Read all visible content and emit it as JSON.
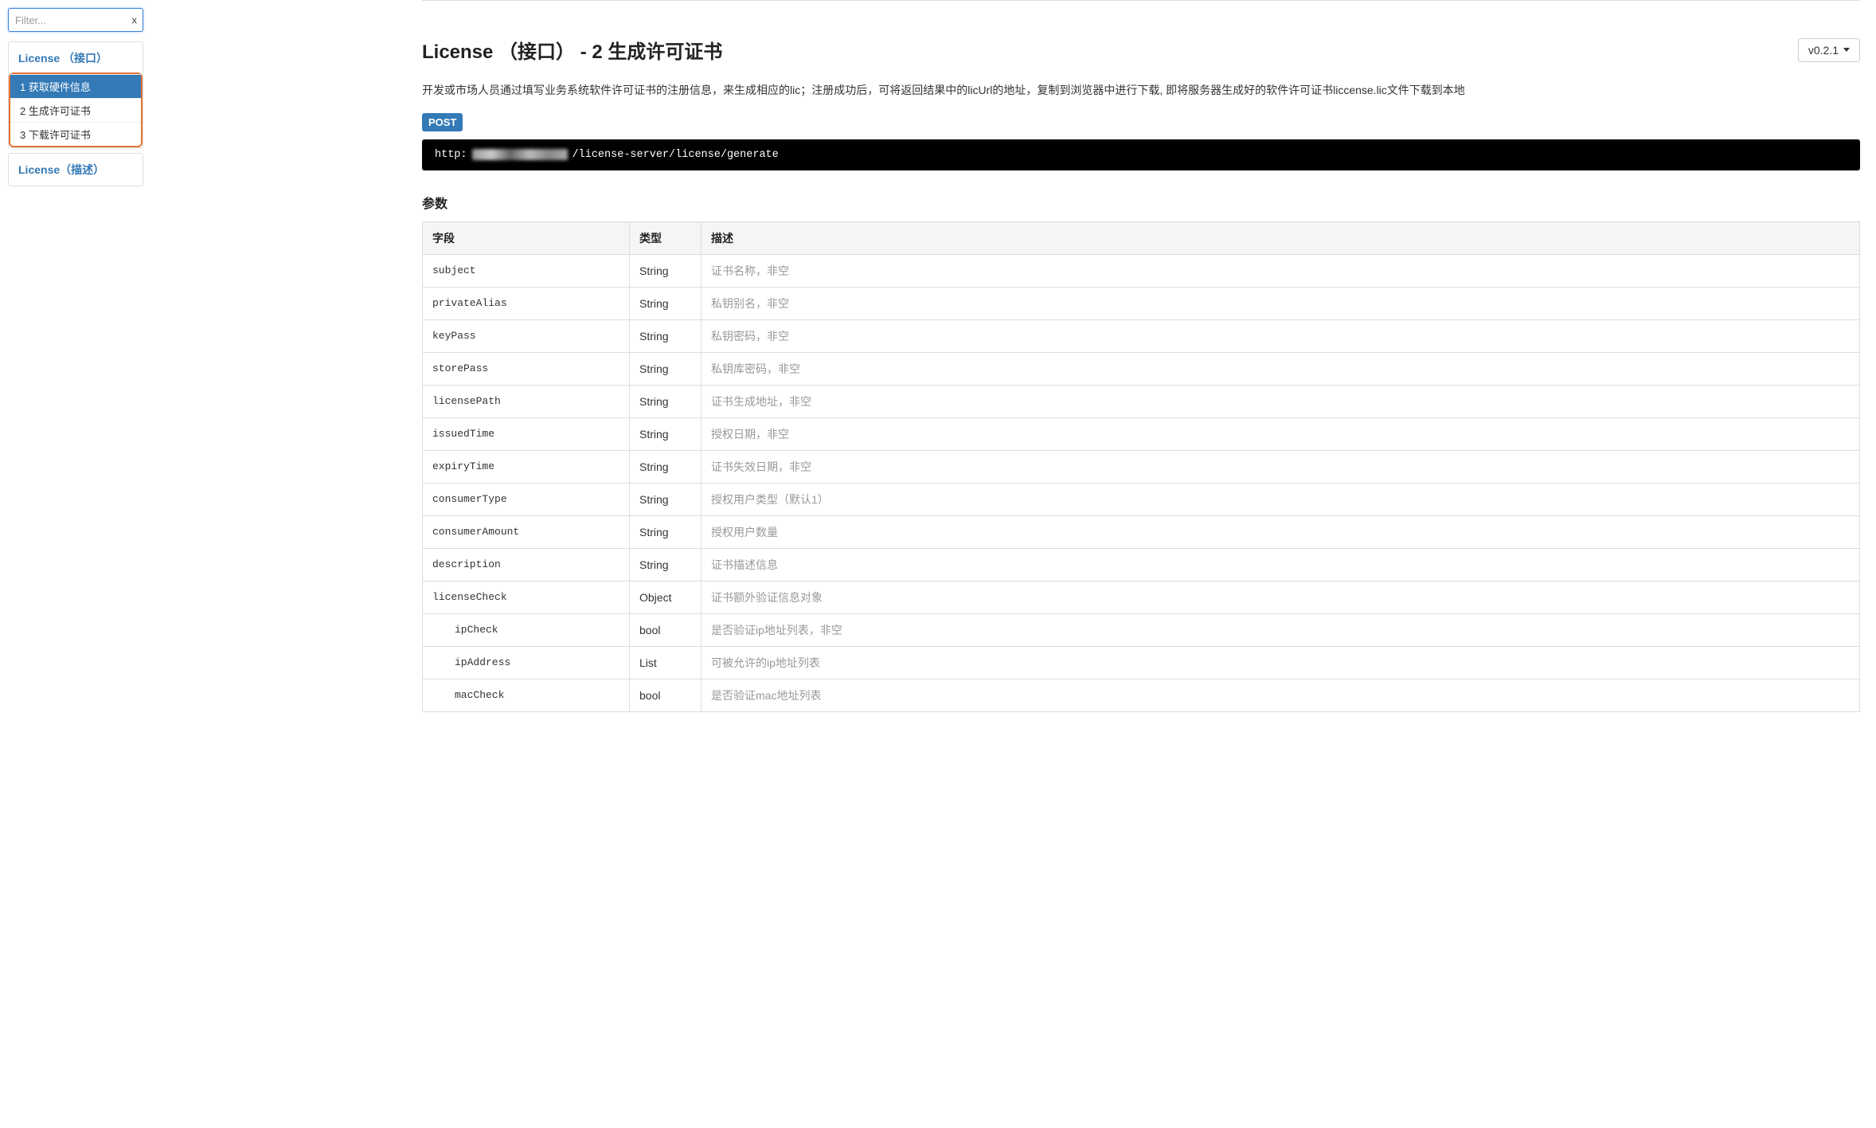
{
  "sidebar": {
    "filter_placeholder": "Filter...",
    "clear_label": "x",
    "groups": [
      {
        "title": "License （接口）",
        "highlighted": true,
        "items": [
          {
            "label": "1 获取硬件信息",
            "active": true
          },
          {
            "label": "2 生成许可证书",
            "active": false
          },
          {
            "label": "3 下载许可证书",
            "active": false
          }
        ]
      },
      {
        "title": "License（描述）",
        "highlighted": false,
        "items": []
      }
    ]
  },
  "header": {
    "title": "License （接口） - 2 生成许可证书",
    "version": "v0.2.1"
  },
  "description": "开发或市场人员通过填写业务系统软件许可证书的注册信息，来生成相应的lic；注册成功后，可将返回结果中的licUrl的地址，复制到浏览器中进行下载, 即将服务器生成好的软件许可证书liccense.lic文件下载到本地",
  "request": {
    "method": "POST",
    "url_prefix": "http:",
    "url_suffix": "/license-server/license/generate"
  },
  "params": {
    "title": "参数",
    "headers": {
      "field": "字段",
      "type": "类型",
      "desc": "描述"
    },
    "rows": [
      {
        "field": "subject",
        "type": "String",
        "desc": "证书名称，非空",
        "indent": false
      },
      {
        "field": "privateAlias",
        "type": "String",
        "desc": "私钥别名，非空",
        "indent": false
      },
      {
        "field": "keyPass",
        "type": "String",
        "desc": "私钥密码，非空",
        "indent": false
      },
      {
        "field": "storePass",
        "type": "String",
        "desc": "私钥库密码，非空",
        "indent": false
      },
      {
        "field": "licensePath",
        "type": "String",
        "desc": "证书生成地址，非空",
        "indent": false
      },
      {
        "field": "issuedTime",
        "type": "String",
        "desc": "授权日期，非空",
        "indent": false
      },
      {
        "field": "expiryTime",
        "type": "String",
        "desc": "证书失效日期，非空",
        "indent": false
      },
      {
        "field": "consumerType",
        "type": "String",
        "desc": "授权用户类型（默认1）",
        "indent": false
      },
      {
        "field": "consumerAmount",
        "type": "String",
        "desc": "授权用户数量",
        "indent": false
      },
      {
        "field": "description",
        "type": "String",
        "desc": "证书描述信息",
        "indent": false
      },
      {
        "field": "licenseCheck",
        "type": "Object",
        "desc": "证书额外验证信息对象",
        "indent": false
      },
      {
        "field": "ipCheck",
        "type": "bool",
        "desc": "是否验证ip地址列表，非空",
        "indent": true
      },
      {
        "field": "ipAddress",
        "type": "List",
        "desc": "可被允许的ip地址列表",
        "indent": true
      },
      {
        "field": "macCheck",
        "type": "bool",
        "desc": "是否验证mac地址列表",
        "indent": true
      }
    ]
  }
}
